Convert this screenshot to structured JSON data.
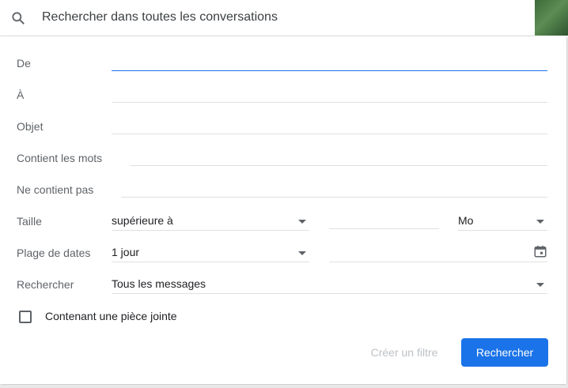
{
  "search": {
    "text": "Rechercher dans toutes les conversations"
  },
  "form": {
    "from_label": "De",
    "to_label": "À",
    "subject_label": "Objet",
    "has_words_label": "Contient les mots",
    "not_words_label": "Ne contient pas",
    "size_label": "Taille",
    "size_operator": "supérieure à",
    "size_unit": "Mo",
    "date_label": "Plage de dates",
    "date_range": "1 jour",
    "search_in_label": "Rechercher",
    "search_in_value": "Tous les messages",
    "attachment_label": "Contenant une pièce jointe"
  },
  "actions": {
    "create_filter": "Créer un filtre",
    "search": "Rechercher"
  },
  "colors": {
    "accent": "#1a73e8",
    "disabled_text": "#bdc1c6",
    "label_text": "#5f6368"
  },
  "icons": {
    "search": "search-icon",
    "calendar": "calendar-icon",
    "dropdown": "chevron-down-icon"
  }
}
